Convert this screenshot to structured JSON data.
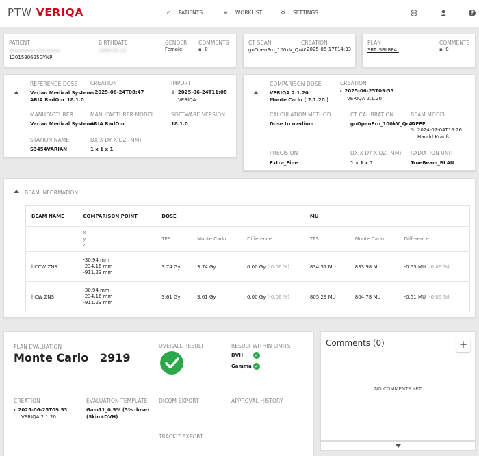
{
  "header": {
    "logo_ptw": "PTW",
    "logo_veriqa": "VERIQA",
    "nav": [
      {
        "label": "PATIENTS",
        "icon": "check-icon"
      },
      {
        "label": "WORKLIST",
        "icon": "list-icon"
      },
      {
        "label": "SETTINGS",
        "icon": "gear-icon"
      }
    ],
    "icons": [
      "globe-icon",
      "user-icon",
      "help-icon"
    ]
  },
  "patient": {
    "label": "PATIENT",
    "name_blurred": "Xxxxxxxxx Xxxxxxxx",
    "id": "1201580625GYNP",
    "birthdate_label": "BIRTHDATE",
    "birthdate_blurred": "1958-01-12",
    "gender_label": "GENDER",
    "gender": "Female",
    "comments_label": "COMMENTS",
    "comments_count": "0"
  },
  "ct_scan": {
    "label": "CT SCAN",
    "value": "goOpenPro_100kV_Qr40",
    "creation_label": "CREATION",
    "creation": "2025-06-17T14:33"
  },
  "plan": {
    "label": "PLAN",
    "value": "SRT_SBLRF4!",
    "comments_label": "COMMENTS",
    "comments_count": "0"
  },
  "reference_dose": {
    "label": "REFERENCE DOSE",
    "name_line1": "Varian Medical Systems",
    "name_line2": "ARIA RadOnc 18.1.0",
    "creation_label": "CREATION",
    "creation": "2025-06-24T08:47",
    "import_label": "IMPORT",
    "import_date": "2025-06-24T11:08",
    "import_by": "VERIQA",
    "manufacturer_label": "MANUFACTURER",
    "manufacturer": "Varian Medical Systems",
    "model_label": "MANUFACTURER MODEL",
    "model": "ARIA RadOnc",
    "software_label": "SOFTWARE VERSION",
    "software": "18.1.0",
    "station_label": "STATION NAME",
    "station": "S3454VARIAN",
    "grid_label": "DX X DY X DZ (MM)",
    "grid": "1 x 1 x 1"
  },
  "comparison_dose": {
    "label": "COMPARISON DOSE",
    "name_line1": "VERIQA 2.1.20",
    "name_line2": "Monte Carlo ( 2.1.20 )",
    "creation_label": "CREATION",
    "creation": "2025-06-25T09:55",
    "creation_by": "VERIQA 2.1.20",
    "calc_label": "CALCULATION METHOD",
    "calc": "Dose to medium",
    "ct_cal_label": "CT CALIBRATION",
    "ct_cal": "goOpenPro_100kV_Qr40",
    "beam_model_label": "BEAM MODEL",
    "beam_model": "6 FFF",
    "beam_model_date": "2024-07-04T16:26",
    "beam_model_user": "Harald Krauß",
    "precision_label": "PRECISION",
    "precision": "Extra_Fine",
    "grid_label": "DX X DY X DZ (MM)",
    "grid": "1 x 1 x 1",
    "radiation_label": "RADIATION UNIT",
    "radiation": "TrueBeam_BLAU"
  },
  "beam_info": {
    "title": "BEAM INFORMATION",
    "headers": [
      "BEAM NAME",
      "COMPARISON POINT",
      "DOSE",
      "MU"
    ],
    "sub": {
      "x": "x",
      "y": "y",
      "z": "z",
      "tps": "TPS",
      "mc": "Monte Carlo",
      "diff": "Difference"
    },
    "rows": [
      {
        "name": "hCCW ZNS",
        "x": "-30.94 mm",
        "y": "-234.16 mm",
        "z": "-911.23 mm",
        "dose_tps": "3.74 Gy",
        "dose_mc": "3.74 Gy",
        "dose_diff": "0.00 Gy",
        "dose_diff_pct": "(-0.06 %)",
        "mu_tps": "834.51 MU",
        "mu_mc": "833.98 MU",
        "mu_diff": "-0.53 MU",
        "mu_diff_pct": "(-0.06 %)"
      },
      {
        "name": "hCW ZNS",
        "x": "-30.94 mm",
        "y": "-234.16 mm",
        "z": "-911.23 mm",
        "dose_tps": "3.61 Gy",
        "dose_mc": "3.61 Gy",
        "dose_diff": "0.00 Gy",
        "dose_diff_pct": "(-0.06 %)",
        "mu_tps": "805.29 MU",
        "mu_mc": "804.78 MU",
        "mu_diff": "-0.51 MU",
        "mu_diff_pct": "(-0.06 %)"
      }
    ]
  },
  "plan_eval": {
    "label": "PLAN EVALUATION",
    "method": "Monte Carlo",
    "number": "2919",
    "overall_label": "OVERALL RESULT",
    "limits_label": "RESULT WITHIN LIMITS",
    "limits": [
      "DVH",
      "Gamma"
    ],
    "creation_label": "CREATION",
    "creation": "2025-06-25T09:53",
    "creation_by": "VERIQA 2.1.20",
    "template_label": "EVALUATION TEMPLATE",
    "template_line1": "Gam11_0.5% (5% dose)",
    "template_line2": "(Skin+DVH)",
    "dicom_label": "DICOM EXPORT",
    "approval_label": "APPROVAL HISTORY",
    "trackit_label": "TRACKIT EXPORT"
  },
  "comments": {
    "title": "Comments (0)",
    "empty": "NO COMMENTS YET",
    "add_symbol": "+"
  },
  "colors": {
    "brand": "#d6001c",
    "ok": "#2ca84a"
  }
}
